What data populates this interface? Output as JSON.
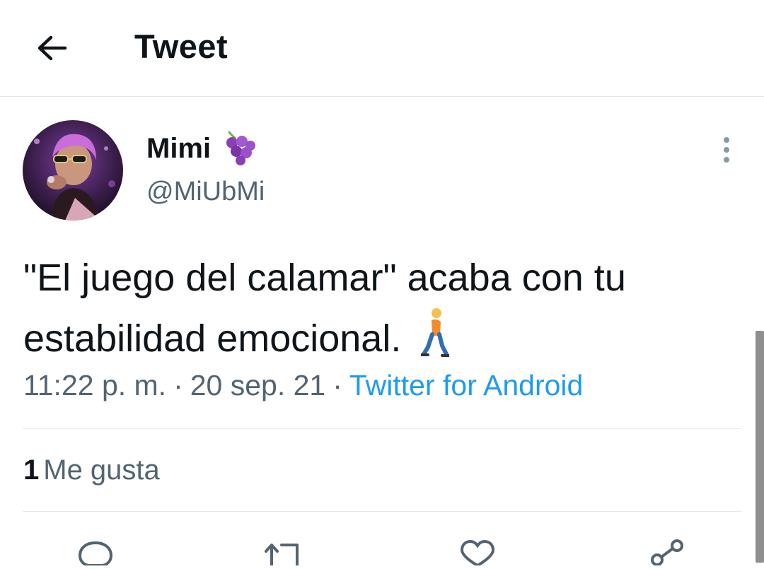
{
  "header": {
    "title": "Tweet",
    "back_icon": "arrow-left-icon"
  },
  "author": {
    "display_name": "Mimi",
    "name_emoji": "grapes-icon",
    "handle": "@MiUbMi",
    "avatar": "profile-photo"
  },
  "tweet": {
    "text": "\"El juego del calamar\" acaba con tu estabilidad emocional.",
    "trailing_emoji": "person-walking-icon"
  },
  "meta": {
    "time": "11:22 p. m.",
    "separator": "·",
    "date": "20 sep. 21",
    "source": "Twitter for Android"
  },
  "stats": {
    "likes_count": "1",
    "likes_label": "Me gusta"
  },
  "actions": [
    "reply-icon",
    "retweet-icon",
    "like-icon",
    "share-icon"
  ],
  "colors": {
    "link": "#1d9bf0",
    "secondary_text": "#536471",
    "divider": "#e1e8ed"
  }
}
